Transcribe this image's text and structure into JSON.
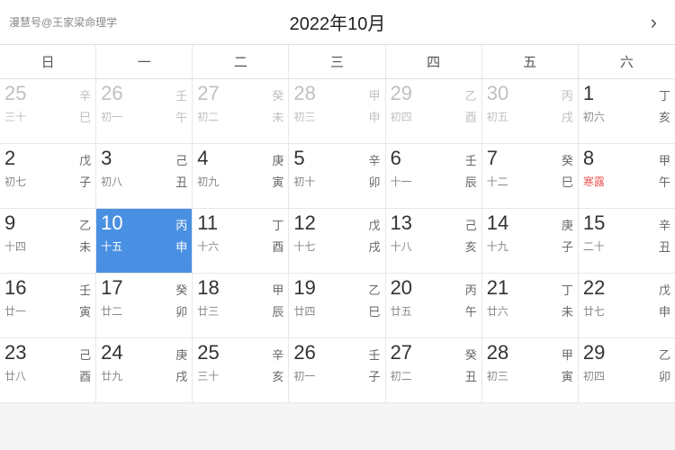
{
  "header": {
    "watermark": "漫慧号@王家梁命理学",
    "title": "2022年10月",
    "arrow": "›"
  },
  "weekdays": [
    "日",
    "一",
    "二",
    "三",
    "四",
    "五",
    "六"
  ],
  "weeks": [
    [
      {
        "date": "25",
        "stem": "辛",
        "branch": "巳",
        "lunar": "三十",
        "otherMonth": true
      },
      {
        "date": "26",
        "stem": "壬",
        "branch": "午",
        "lunar": "初一",
        "otherMonth": true
      },
      {
        "date": "27",
        "stem": "癸",
        "branch": "未",
        "lunar": "初二",
        "otherMonth": true
      },
      {
        "date": "28",
        "stem": "甲",
        "branch": "申",
        "lunar": "初三",
        "otherMonth": true
      },
      {
        "date": "29",
        "stem": "乙",
        "branch": "酉",
        "lunar": "初四",
        "otherMonth": true
      },
      {
        "date": "30",
        "stem": "丙",
        "branch": "戌",
        "lunar": "初五",
        "otherMonth": true
      },
      {
        "date": "1",
        "stem": "丁",
        "branch": "亥",
        "lunar": "初六",
        "otherMonth": false
      }
    ],
    [
      {
        "date": "2",
        "stem": "戊",
        "branch": "子",
        "lunar": "初七",
        "otherMonth": false
      },
      {
        "date": "3",
        "stem": "己",
        "branch": "丑",
        "lunar": "初八",
        "otherMonth": false
      },
      {
        "date": "4",
        "stem": "庚",
        "branch": "寅",
        "lunar": "初九",
        "otherMonth": false
      },
      {
        "date": "5",
        "stem": "辛",
        "branch": "卯",
        "lunar": "初十",
        "otherMonth": false
      },
      {
        "date": "6",
        "stem": "壬",
        "branch": "辰",
        "lunar": "十一",
        "otherMonth": false
      },
      {
        "date": "7",
        "stem": "癸",
        "branch": "巳",
        "lunar": "十二",
        "otherMonth": false
      },
      {
        "date": "8",
        "stem": "甲",
        "branch": "午",
        "lunar": "寒露",
        "otherMonth": false,
        "solarTerm": "寒露"
      }
    ],
    [
      {
        "date": "9",
        "stem": "乙",
        "branch": "未",
        "lunar": "十四",
        "otherMonth": false
      },
      {
        "date": "10",
        "stem": "丙",
        "branch": "申",
        "lunar": "十五",
        "otherMonth": false,
        "selected": true
      },
      {
        "date": "11",
        "stem": "丁",
        "branch": "酉",
        "lunar": "十六",
        "otherMonth": false
      },
      {
        "date": "12",
        "stem": "戊",
        "branch": "戌",
        "lunar": "十七",
        "otherMonth": false
      },
      {
        "date": "13",
        "stem": "己",
        "branch": "亥",
        "lunar": "十八",
        "otherMonth": false
      },
      {
        "date": "14",
        "stem": "庚",
        "branch": "子",
        "lunar": "十九",
        "otherMonth": false
      },
      {
        "date": "15",
        "stem": "辛",
        "branch": "丑",
        "lunar": "二十",
        "otherMonth": false
      }
    ],
    [
      {
        "date": "16",
        "stem": "壬",
        "branch": "寅",
        "lunar": "廿一",
        "otherMonth": false
      },
      {
        "date": "17",
        "stem": "癸",
        "branch": "卯",
        "lunar": "廿二",
        "otherMonth": false
      },
      {
        "date": "18",
        "stem": "甲",
        "branch": "辰",
        "lunar": "廿三",
        "otherMonth": false
      },
      {
        "date": "19",
        "stem": "乙",
        "branch": "巳",
        "lunar": "廿四",
        "otherMonth": false
      },
      {
        "date": "20",
        "stem": "丙",
        "branch": "午",
        "lunar": "廿五",
        "otherMonth": false
      },
      {
        "date": "21",
        "stem": "丁",
        "branch": "未",
        "lunar": "廿六",
        "otherMonth": false
      },
      {
        "date": "22",
        "stem": "戊",
        "branch": "申",
        "lunar": "廿七",
        "otherMonth": false
      }
    ],
    [
      {
        "date": "23",
        "stem": "己",
        "branch": "酉",
        "lunar": "廿八",
        "otherMonth": false
      },
      {
        "date": "24",
        "stem": "庚",
        "branch": "戌",
        "lunar": "廿九",
        "otherMonth": false
      },
      {
        "date": "25",
        "stem": "辛",
        "branch": "亥",
        "lunar": "三十",
        "otherMonth": false
      },
      {
        "date": "26",
        "stem": "壬",
        "branch": "子",
        "lunar": "初一",
        "otherMonth": false
      },
      {
        "date": "27",
        "stem": "癸",
        "branch": "丑",
        "lunar": "初二",
        "otherMonth": false
      },
      {
        "date": "28",
        "stem": "甲",
        "branch": "寅",
        "lunar": "初三",
        "otherMonth": false
      },
      {
        "date": "29",
        "stem": "乙",
        "branch": "卯",
        "lunar": "初四",
        "otherMonth": false
      }
    ]
  ]
}
